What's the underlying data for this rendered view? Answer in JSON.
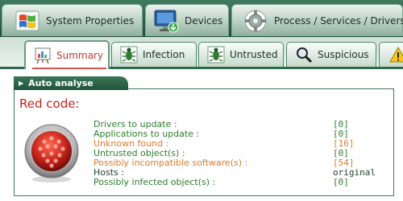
{
  "top_tabs": [
    {
      "label": "System Properties",
      "icon": "windows-logo-icon"
    },
    {
      "label": "Devices",
      "icon": "monitor-icon"
    },
    {
      "label": "Process / Services / Drivers",
      "icon": "gear-icon"
    }
  ],
  "sub_tabs": [
    {
      "label": "Summary",
      "icon": "presentation-board-icon",
      "active": true
    },
    {
      "label": "Infection",
      "icon": "bug-icon"
    },
    {
      "label": "Untrusted",
      "icon": "bug-icon"
    },
    {
      "label": "Suspicious",
      "icon": "magnifier-icon"
    },
    {
      "label": "",
      "icon": "warning-icon"
    }
  ],
  "panel": {
    "header": "Auto analyse",
    "status_title": "Red code:",
    "rows": [
      {
        "label": "Drivers to update :",
        "value": "[0]",
        "color": "#2d7d2d"
      },
      {
        "label": "Applications to update :",
        "value": "[0]",
        "color": "#2d7d2d"
      },
      {
        "label": "Unknown found :",
        "value": "[16]",
        "color": "#e07a2e"
      },
      {
        "label": "Untrusted object(s) :",
        "value": "[0]",
        "color": "#2d7d2d"
      },
      {
        "label": "Possibly incompatible software(s) :",
        "value": "[54]",
        "color": "#e07a2e"
      },
      {
        "label": "Hosts :",
        "value": "original",
        "color": "#1f3c2c"
      },
      {
        "label": "Possibly infected object(s) :",
        "value": "[0]",
        "color": "#2d7d2d"
      }
    ]
  },
  "colors": {
    "accent_green": "#2f6a4e",
    "alert_red": "#cc1f1a",
    "warning_orange": "#e07a2e"
  }
}
